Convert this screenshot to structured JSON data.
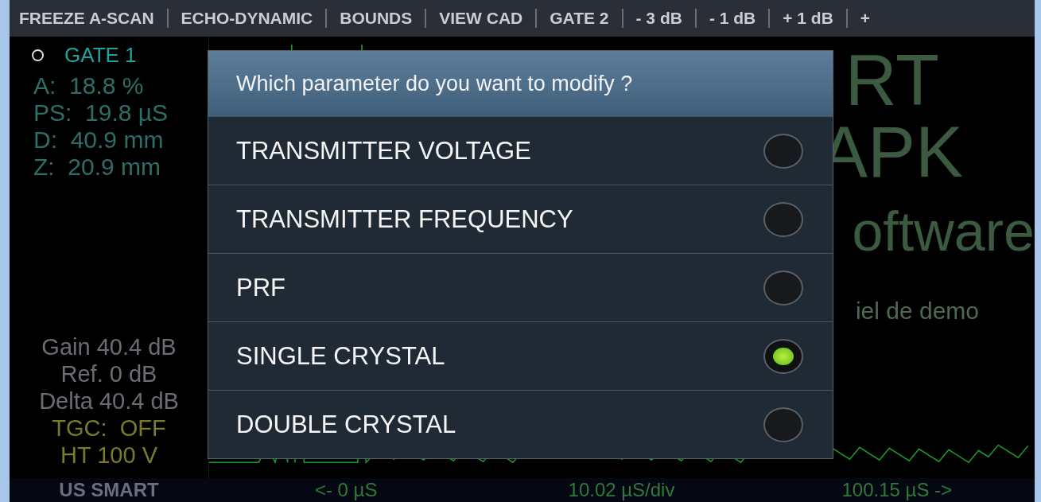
{
  "toolbar": {
    "items": [
      "FREEZE A-SCAN",
      "ECHO-DYNAMIC",
      "BOUNDS",
      "VIEW CAD",
      "GATE 2",
      "- 3 dB",
      "- 1 dB",
      "+ 1 dB",
      "+"
    ]
  },
  "gate_panel": {
    "title": "GATE 1",
    "readings": [
      "A:  18.8 %",
      "PS:  19.8 µS",
      "D:  40.9 mm",
      "Z:  20.9 mm"
    ]
  },
  "settings_panel": {
    "lines": [
      {
        "text": "Gain 40.4 dB",
        "kind": "gray"
      },
      {
        "text": "Ref. 0 dB",
        "kind": "gray"
      },
      {
        "text": "Delta 40.4 dB",
        "kind": "gray"
      },
      {
        "text": "TGC:  OFF",
        "kind": "yellow"
      },
      {
        "text": "HT 100 V",
        "kind": "yellow"
      }
    ]
  },
  "background_text": [
    "RT",
    "APK",
    "oftware",
    "iel de demo"
  ],
  "bottom_bar": {
    "brand": "US SMART",
    "start": "<- 0 µS",
    "scale": "10.02 µS/div",
    "end": "100.15 µS ->"
  },
  "dialog": {
    "title": "Which parameter do you want to modify ?",
    "options": [
      {
        "label": "TRANSMITTER VOLTAGE",
        "selected": false
      },
      {
        "label": "TRANSMITTER FREQUENCY",
        "selected": false
      },
      {
        "label": "PRF",
        "selected": false
      },
      {
        "label": "SINGLE CRYSTAL",
        "selected": true
      },
      {
        "label": "DOUBLE CRYSTAL",
        "selected": false
      }
    ]
  }
}
